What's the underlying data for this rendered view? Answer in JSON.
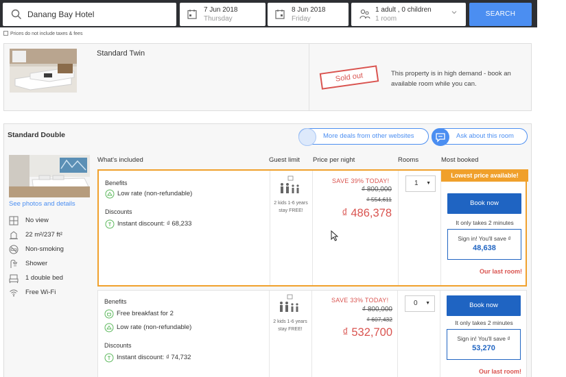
{
  "search": {
    "destination": "Danang Bay Hotel",
    "checkin_date": "7 Jun 2018",
    "checkin_day": "Thursday",
    "checkout_date": "8 Jun 2018",
    "checkout_day": "Friday",
    "occupancy": "1 adult , 0 children",
    "rooms": "1 room",
    "search_label": "SEARCH",
    "tax_note": "Prices do not include taxes & fees"
  },
  "sold_out_room": {
    "name": "Standard Twin",
    "stamp": "Sold out",
    "message": "This property is in high demand - book an available room while you can."
  },
  "room": {
    "name": "Standard Double",
    "more_deals_label": "More deals from other websites",
    "ask_label": "Ask about this room",
    "see_photos": "See photos and details",
    "features": [
      {
        "icon": "window-icon",
        "label": "No view"
      },
      {
        "icon": "room-size-icon",
        "label": "22 m²/237 ft²"
      },
      {
        "icon": "no-smoking-icon",
        "label": "Non-smoking"
      },
      {
        "icon": "shower-icon",
        "label": "Shower"
      },
      {
        "icon": "bed-icon",
        "label": "1 double bed"
      },
      {
        "icon": "wifi-icon",
        "label": "Free Wi-Fi"
      }
    ]
  },
  "columns": {
    "included": "What's included",
    "guest_limit": "Guest limit",
    "price": "Price per night",
    "rooms": "Rooms",
    "most_booked": "Most booked"
  },
  "offers": [
    {
      "benefits_label": "Benefits",
      "benefits": [
        "Low rate (non-refundable)"
      ],
      "discounts_label": "Discounts",
      "discount": "Instant discount: ₫ 68,233",
      "kids_note": "2 kids 1-6 years stay FREE!",
      "save": "SAVE 39% TODAY!",
      "original_price": "₫ 800,000",
      "crossed_price": "₫ 554,611",
      "price": "₫ 486,378",
      "rooms_selected": "1",
      "lowest_badge": "Lowest price available!",
      "book_label": "Book now",
      "takes_note": "It only takes 2 minutes",
      "signin_text": "Sign in! You'll save ₫",
      "signin_value": "48,638",
      "last_room": "Our last room!"
    },
    {
      "benefits_label": "Benefits",
      "benefits": [
        "Free breakfast for 2",
        "Low rate (non-refundable)"
      ],
      "discounts_label": "Discounts",
      "discount": "Instant discount: ₫ 74,732",
      "kids_note": "2 kids 1-6 years stay FREE!",
      "save": "SAVE 33% TODAY!",
      "original_price": "₫ 800,000",
      "crossed_price": "₫ 607,432",
      "price": "₫ 532,700",
      "rooms_selected": "0",
      "book_label": "Book now",
      "takes_note": "It only takes 2 minutes",
      "signin_text": "Sign in! You'll save ₫",
      "signin_value": "53,270",
      "last_room": "Our last room!"
    }
  ],
  "colors": {
    "accent_blue": "#4b8ef1",
    "book_blue": "#1f64c2",
    "price_red": "#d9534f",
    "highlight_orange": "#f0a02b",
    "topbar": "#2d2f33"
  }
}
